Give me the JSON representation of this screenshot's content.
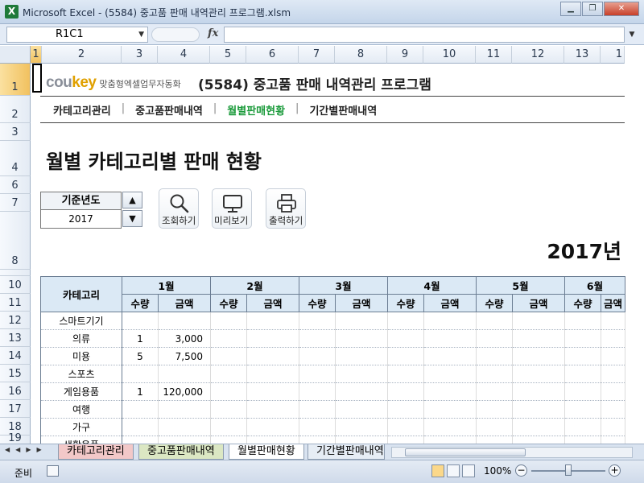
{
  "window": {
    "icon_letter": "X",
    "title": "Microsoft Excel - (5584) 중고품 판매 내역관리 프로그램.xlsm",
    "btn_minimize": "▁",
    "btn_restore": "❐",
    "btn_close": "✕"
  },
  "formula_bar": {
    "name_box": "R1C1",
    "fx_label": "fx",
    "formula": ""
  },
  "columns": [
    "1",
    "2",
    "3",
    "4",
    "5",
    "6",
    "7",
    "8",
    "9",
    "10",
    "11",
    "12",
    "13",
    "1"
  ],
  "rows": [
    "1",
    "2",
    "3",
    "4",
    "6",
    "7",
    "8",
    "10",
    "11",
    "12",
    "13",
    "14",
    "15",
    "16",
    "17",
    "18",
    "19"
  ],
  "header": {
    "brand_logo_a": "cou",
    "brand_logo_b": "key",
    "brand_sub": "맞춤형엑셀업무자동화",
    "program_title": "(5584) 중고품 판매 내역관리 프로그램"
  },
  "nav": {
    "items": [
      {
        "label": "카테고리관리"
      },
      {
        "label": "중고품판매내역"
      },
      {
        "label": "월별판매현황"
      },
      {
        "label": "기간별판매내역"
      }
    ],
    "separator": "|"
  },
  "page": {
    "title": "월별 카테고리별 판매 현황",
    "year_label": "기준년도",
    "year_value": "2017",
    "spin_up": "▲",
    "spin_down": "▼",
    "year_heading": "2017년",
    "tools": [
      {
        "label": "조회하기",
        "icon": "search-icon"
      },
      {
        "label": "미리보기",
        "icon": "monitor-icon"
      },
      {
        "label": "출력하기",
        "icon": "printer-icon"
      }
    ]
  },
  "table": {
    "category_header": "카테고리",
    "months": [
      "1월",
      "2월",
      "3월",
      "4월",
      "5월",
      "6월"
    ],
    "sub_qty": "수량",
    "sub_amount": "금액",
    "rows": [
      {
        "category": "스마트기기",
        "qty": "",
        "amount": ""
      },
      {
        "category": "의류",
        "qty": "1",
        "amount": "3,000"
      },
      {
        "category": "미용",
        "qty": "5",
        "amount": "7,500"
      },
      {
        "category": "스포츠",
        "qty": "",
        "amount": ""
      },
      {
        "category": "게임용품",
        "qty": "1",
        "amount": "120,000"
      },
      {
        "category": "여행",
        "qty": "",
        "amount": ""
      },
      {
        "category": "가구",
        "qty": "",
        "amount": ""
      },
      {
        "category": "생활용품",
        "qty": "",
        "amount": ""
      }
    ]
  },
  "sheet_tabs": {
    "nav_first": "◀",
    "nav_prev": "◀",
    "nav_next": "▶",
    "nav_last": "▶",
    "tabs": [
      "카테고리관리",
      "중고품판매내역",
      "월별판매현황",
      "기간별판매내역"
    ]
  },
  "status": {
    "ready": "준비",
    "zoom": "100%",
    "zoom_minus": "−",
    "zoom_plus": "+"
  }
}
